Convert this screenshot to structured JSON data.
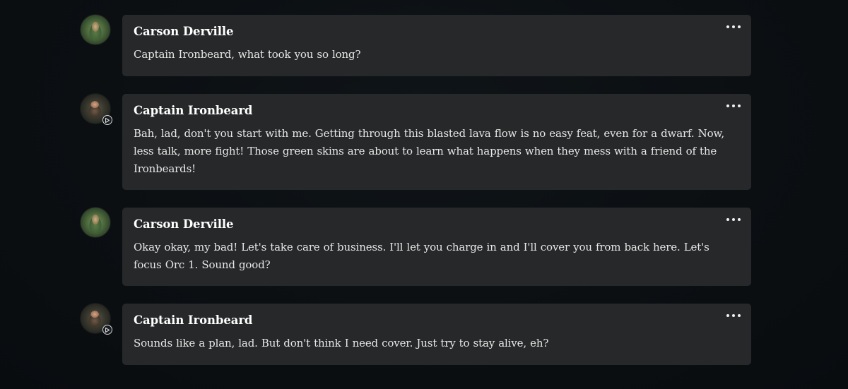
{
  "messages": [
    {
      "author": "Carson Derville",
      "avatar": "elf-ranger-avatar",
      "voice": false,
      "text": "Captain Ironbeard, what took you so long?"
    },
    {
      "author": "Captain Ironbeard",
      "avatar": "dwarf-warrior-avatar",
      "voice": true,
      "text": "Bah, lad, don't you start with me. Getting through this blasted lava flow is no easy feat, even for a dwarf. Now, less talk, more fight! Those green skins are about to learn what happens when they mess with a friend of the Ironbeards!"
    },
    {
      "author": "Carson Derville",
      "avatar": "elf-ranger-avatar",
      "voice": false,
      "text": "Okay okay, my bad! Let's take care of business. I'll let you charge in and I'll cover you from back here. Let's focus Orc 1. Sound good?"
    },
    {
      "author": "Captain Ironbeard",
      "avatar": "dwarf-warrior-avatar",
      "voice": true,
      "text": "Sounds like a plan, lad. But don't think I need cover. Just try to stay alive, eh?"
    }
  ],
  "icons": {
    "more": "more-options-icon",
    "voice": "play-voice-icon"
  },
  "colors": {
    "background": "#0b0f12",
    "bubble": "#262829",
    "name": "#ffffff",
    "text": "#e7e7e7"
  }
}
